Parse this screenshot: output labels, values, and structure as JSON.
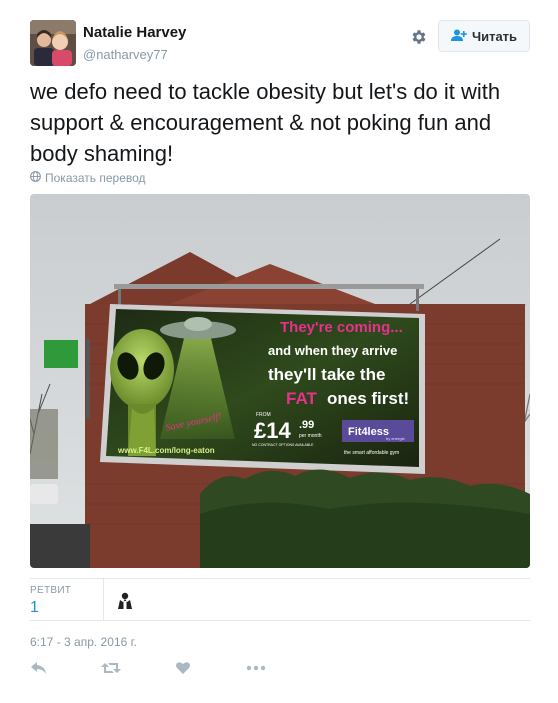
{
  "user": {
    "name": "Natalie Harvey",
    "handle": "@natharvey77"
  },
  "header": {
    "follow_label": "Читать",
    "icons": {
      "settings": "gear-icon",
      "follow": "add-user-icon"
    }
  },
  "tweet": {
    "text": "we defo need to tackle obesity but let's do it with support & encouragement & not poking fun and body shaming!",
    "translate_label": "Показать перевод",
    "timestamp": "6:17 - 3 апр. 2016 г."
  },
  "billboard": {
    "headline1": "They're coming...",
    "headline2": "and when they arrive",
    "headline3": "they'll take the",
    "headline4_a": "FAT",
    "headline4_b": "ones first!",
    "slogan": "Save yourself!",
    "from_label": "FROM",
    "price_main": "£14",
    "price_pence": ".99",
    "price_unit": "per month",
    "contract_note": "NO CONTRACT OPTIONS AVAILABLE",
    "brand": "Fit4less",
    "brand_sub": "by energie",
    "tagline": "the smart affordable gym",
    "url": "www.F4L.com/long-eaton"
  },
  "stats": {
    "retweets_label": "РЕТВИТ",
    "retweets_count": "1"
  },
  "colors": {
    "link": "#1b95e0",
    "muted": "#8899a6",
    "text": "#14171a",
    "billboard_pink": "#e8308c",
    "billboard_green": "#5a8a2a"
  }
}
